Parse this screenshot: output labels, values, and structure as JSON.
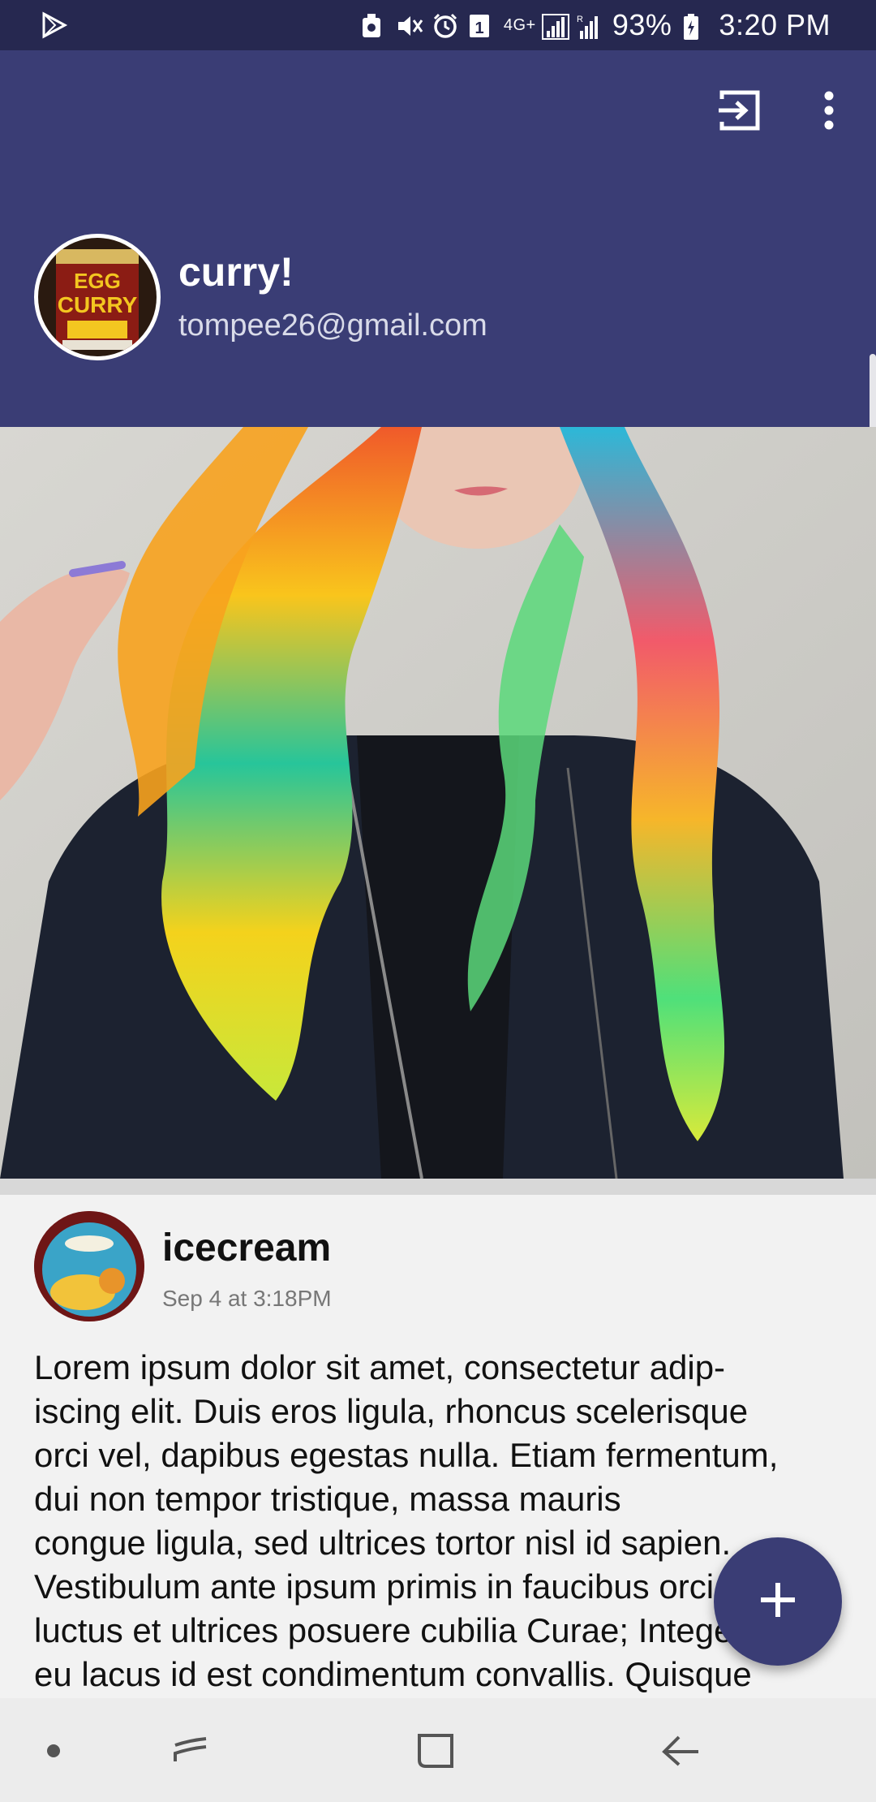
{
  "status_bar": {
    "network": "4G+",
    "battery": "93%",
    "time": "3:20 PM",
    "icons": [
      "play-store-icon",
      "eco-icon",
      "mute-icon",
      "alarm-icon",
      "sim-icon",
      "signal-icon",
      "signal-roaming-icon",
      "battery-icon"
    ]
  },
  "toolbar": {
    "icons": [
      "logout-icon",
      "more-vert-icon"
    ]
  },
  "profile": {
    "name": "curry!",
    "email": "tompee26@gmail.com",
    "avatar_text": "EGG CURRY"
  },
  "post": {
    "author": "icecream",
    "timestamp": "Sep 4 at 3:18PM",
    "body": "Lorem ipsum dolor sit amet, consectetur adip-\niscing elit. Duis eros ligula, rhoncus scelerisque\norci vel, dapibus egestas nulla. Etiam fermentum,\ndui non tempor tristique, massa mauris\ncongue ligula, sed ultrices tortor nisl id sapien.\nVestibulum ante ipsum primis in faucibus orci\nluctus et ultrices posuere cubilia Curae; Integer\neu lacus id est condimentum convallis. Quisque"
  },
  "fab": {
    "label": "+"
  },
  "colors": {
    "primary": "#3a3d75",
    "status_bar": "#262850",
    "background": "#f2f2f2"
  }
}
